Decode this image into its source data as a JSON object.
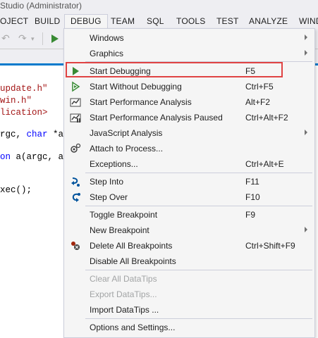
{
  "window": {
    "title": "Studio (Administrator)"
  },
  "menubar": {
    "items": [
      "OJECT",
      "BUILD",
      "DEBUG",
      "TEAM",
      "SQL",
      "TOOLS",
      "TEST",
      "ANALYZE",
      "WIND"
    ]
  },
  "editor": {
    "lines": [
      {
        "text": "update.h\""
      },
      {
        "text": "win.h\""
      },
      {
        "text": "lication>"
      },
      {
        "prefix": "rgc, ",
        "kw": "char",
        "suffix": " *arg"
      },
      {
        "prefix": "",
        "kw": "on",
        "suffix": " a(argc, arg"
      },
      {
        "text": "xec();"
      }
    ]
  },
  "debug_menu": {
    "items": [
      {
        "label": "Windows",
        "shortcut": "",
        "submenu": true,
        "icon": ""
      },
      {
        "label": "Graphics",
        "shortcut": "",
        "submenu": true,
        "icon": ""
      },
      {
        "label": "Start Debugging",
        "shortcut": "F5",
        "submenu": false,
        "icon": "play-icon",
        "highlighted": true
      },
      {
        "label": "Start Without Debugging",
        "shortcut": "Ctrl+F5",
        "submenu": false,
        "icon": "play-outline-icon"
      },
      {
        "label": "Start Performance Analysis",
        "shortcut": "Alt+F2",
        "submenu": false,
        "icon": "performance-icon"
      },
      {
        "label": "Start Performance Analysis Paused",
        "shortcut": "Ctrl+Alt+F2",
        "submenu": false,
        "icon": "performance-paused-icon"
      },
      {
        "label": "JavaScript Analysis",
        "shortcut": "",
        "submenu": true,
        "icon": ""
      },
      {
        "label": "Attach to Process...",
        "shortcut": "",
        "submenu": false,
        "icon": "attach-process-icon"
      },
      {
        "label": "Exceptions...",
        "shortcut": "Ctrl+Alt+E",
        "submenu": false,
        "icon": ""
      },
      {
        "label": "Step Into",
        "shortcut": "F11",
        "submenu": false,
        "icon": "step-into-icon"
      },
      {
        "label": "Step Over",
        "shortcut": "F10",
        "submenu": false,
        "icon": "step-over-icon"
      },
      {
        "label": "Toggle Breakpoint",
        "shortcut": "F9",
        "submenu": false,
        "icon": ""
      },
      {
        "label": "New Breakpoint",
        "shortcut": "",
        "submenu": true,
        "icon": ""
      },
      {
        "label": "Delete All Breakpoints",
        "shortcut": "Ctrl+Shift+F9",
        "submenu": false,
        "icon": "delete-breakpoints-icon"
      },
      {
        "label": "Disable All Breakpoints",
        "shortcut": "",
        "submenu": false,
        "icon": ""
      },
      {
        "label": "Clear All DataTips",
        "shortcut": "",
        "submenu": false,
        "icon": "",
        "disabled": true
      },
      {
        "label": "Export DataTips...",
        "shortcut": "",
        "submenu": false,
        "icon": "",
        "disabled": true
      },
      {
        "label": "Import DataTips ...",
        "shortcut": "",
        "submenu": false,
        "icon": ""
      },
      {
        "label": "Options and Settings...",
        "shortcut": "",
        "submenu": false,
        "icon": ""
      }
    ]
  },
  "colors": {
    "accent": "#007acc",
    "highlight_border": "#e04343",
    "play_green": "#388a34"
  }
}
